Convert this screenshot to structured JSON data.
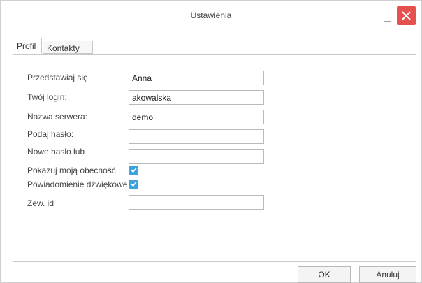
{
  "window": {
    "title": "Ustawienia",
    "close_color": "#e5524e",
    "accent_color": "#3ea2dd"
  },
  "tabs": [
    {
      "label": "Profil",
      "active": true
    },
    {
      "label": "Kontakty",
      "active": false
    }
  ],
  "form": {
    "display_name": {
      "label": "Przedstawiaj się",
      "value": "Anna"
    },
    "login": {
      "label": "Twój login:",
      "value": "akowalska"
    },
    "server": {
      "label": "Nazwa serwera:",
      "value": "demo"
    },
    "password": {
      "label": "Podaj hasło:",
      "value": ""
    },
    "new_password": {
      "label": "Nowe hasło lub",
      "value": ""
    },
    "show_presence": {
      "label": "Pokazuj moją obecność",
      "checked": true
    },
    "sound_notification": {
      "label": "Powiadomienie dźwiękowe",
      "checked": true
    },
    "external_id": {
      "label": "Zew. id",
      "value": ""
    }
  },
  "footer": {
    "ok_label": "OK",
    "cancel_label": "Anuluj"
  }
}
